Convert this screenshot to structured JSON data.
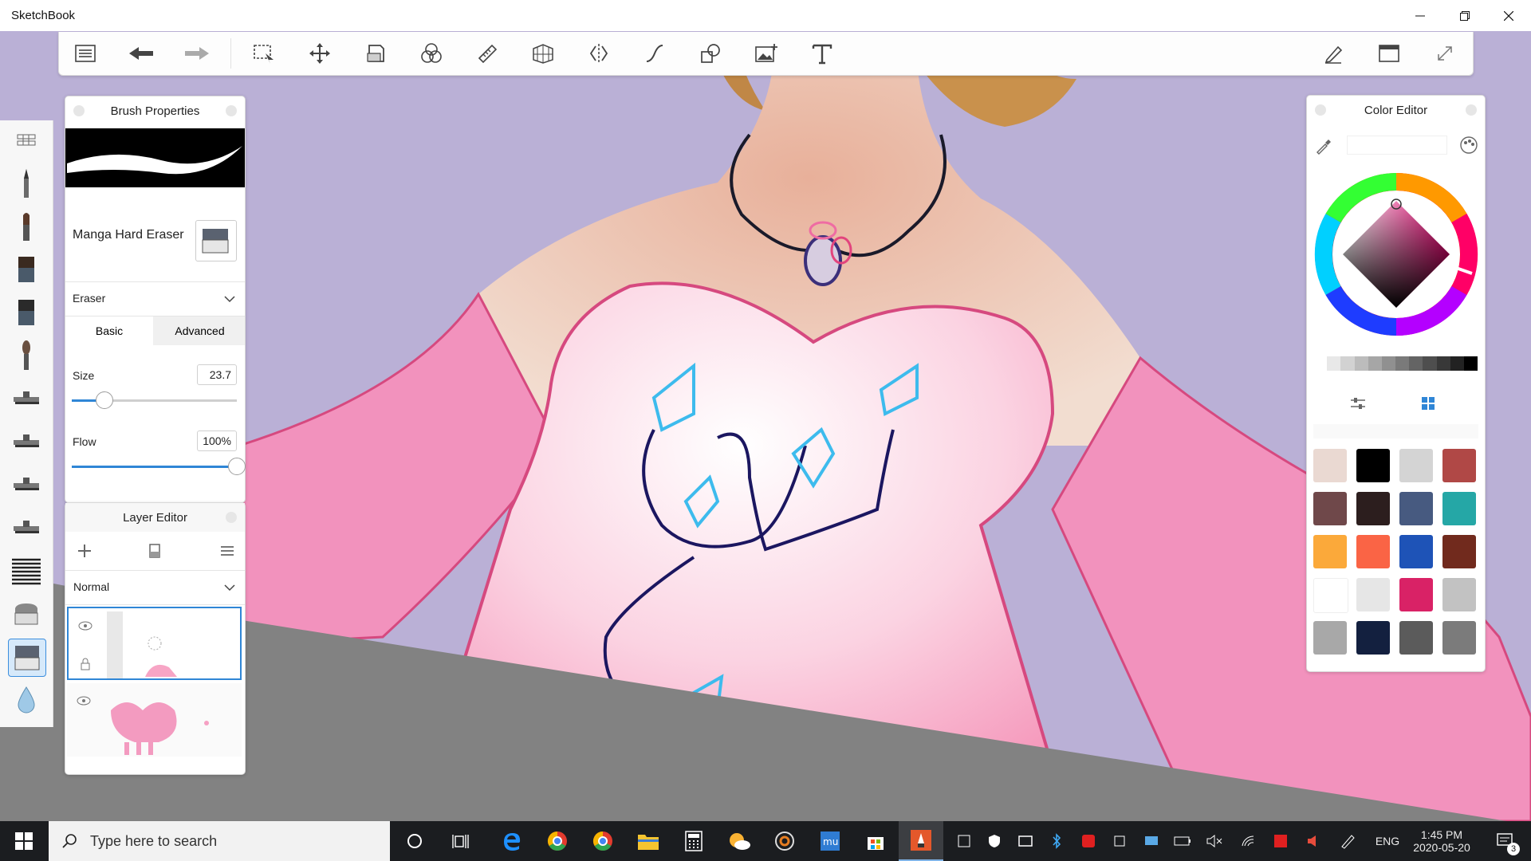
{
  "app": {
    "title": "SketchBook"
  },
  "brush_panel": {
    "title": "Brush Properties",
    "brush_name": "Manga Hard Eraser",
    "brush_type": "Eraser",
    "tabs": [
      "Basic",
      "Advanced"
    ],
    "active_tab": "Basic",
    "size_label": "Size",
    "size_value": "23.7",
    "size_fraction": 0.2,
    "flow_label": "Flow",
    "flow_value": "100%",
    "flow_fraction": 1.0
  },
  "layer_panel": {
    "title": "Layer Editor",
    "blend_mode": "Normal"
  },
  "color_panel": {
    "title": "Color Editor",
    "current_color": "#6a1f3f",
    "grays": [
      "#ffffff",
      "#e8e8e8",
      "#d2d2d2",
      "#bcbcbc",
      "#a6a6a6",
      "#909090",
      "#7a7a7a",
      "#646464",
      "#4e4e4e",
      "#383838",
      "#222222",
      "#000000"
    ],
    "swatches": [
      "#ead9d2",
      "#000000",
      "#d4d4d4",
      "#b04846",
      "#6f484a",
      "#2c1e1e",
      "#475a80",
      "#25a7a6",
      "#fba93a",
      "#fa6445",
      "#1e53b7",
      "#712a1d",
      "#ffffff",
      "#e6e6e6",
      "#d92266",
      "#c2c2c2",
      "#a8a8a8",
      "#13203f",
      "#5b5b5b",
      "#7b7b7b"
    ]
  },
  "taskbar": {
    "search_placeholder": "Type here to search",
    "language": "ENG",
    "time": "1:45 PM",
    "date": "2020-05-20",
    "notification_count": "3"
  },
  "icons": {
    "toolbar": [
      "list-icon",
      "undo-icon",
      "redo-icon",
      "selection-icon",
      "transform-icon",
      "layer-icon",
      "color-mix-icon",
      "ruler-icon",
      "perspective-icon",
      "symmetry-icon",
      "curve-icon",
      "shape-icon",
      "image-icon",
      "text-icon",
      "pen-icon",
      "window-icon",
      "fullscreen-icon"
    ],
    "left_tools": [
      "brush-library-icon",
      "pencil-icon",
      "paintbrush-icon",
      "flat-brush-icon",
      "wide-brush-icon",
      "round-brush-icon",
      "airbrush-icon",
      "airbrush-2-icon",
      "airbrush-3-icon",
      "airbrush-4-icon",
      "hatch-brush-icon",
      "eraser-icon",
      "hard-eraser-icon",
      "blur-icon"
    ]
  }
}
